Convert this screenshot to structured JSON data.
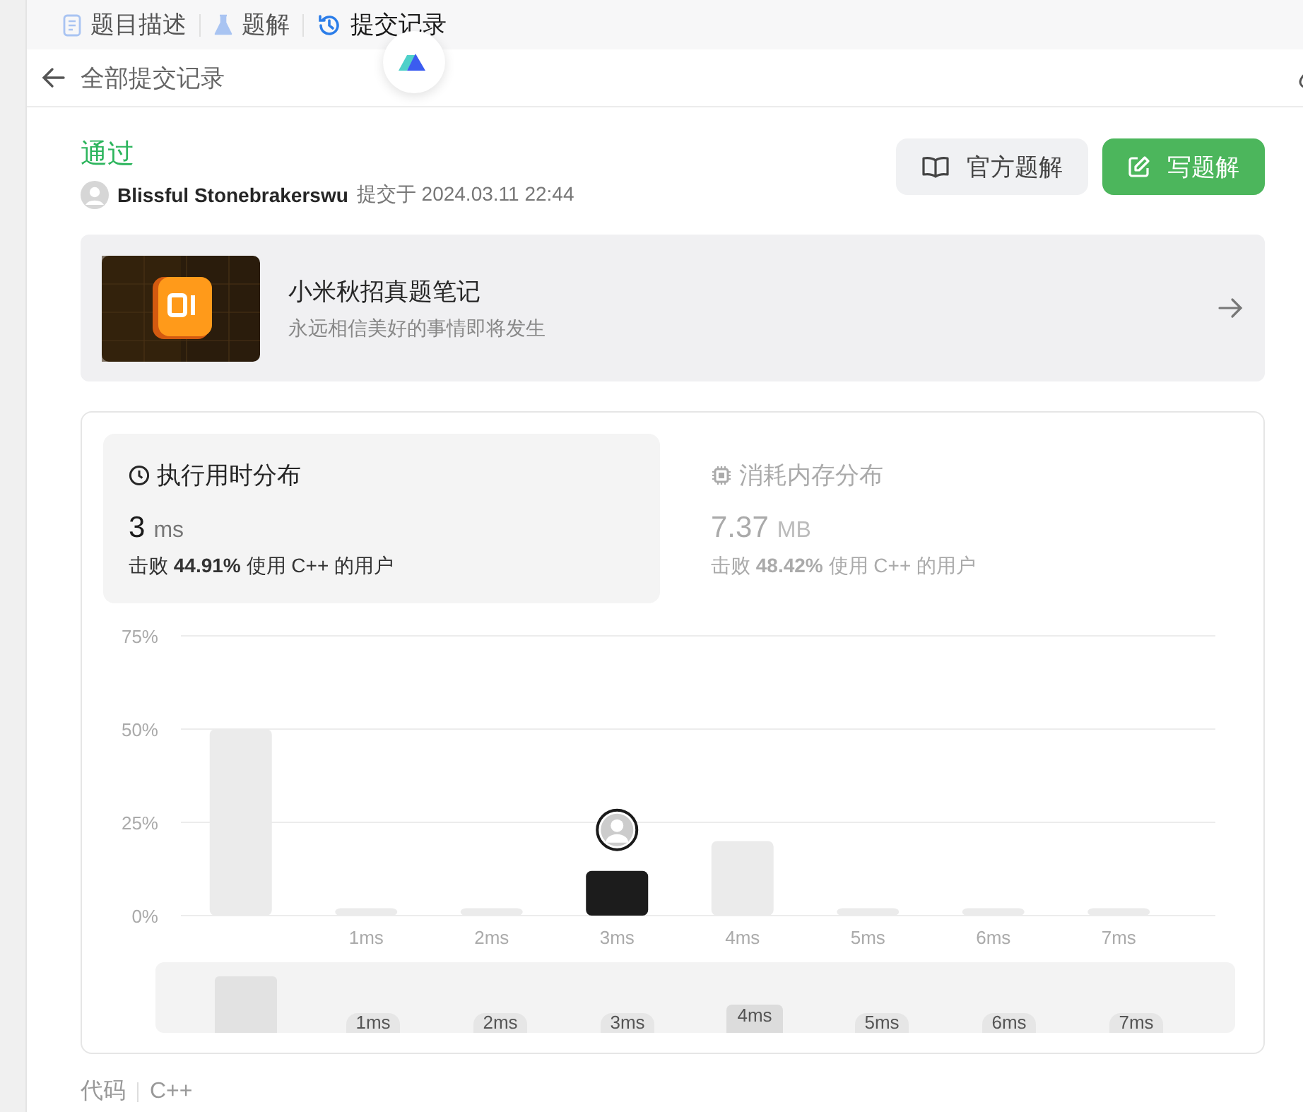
{
  "tabs": [
    {
      "label": "题目描述",
      "selected": false
    },
    {
      "label": "题解",
      "selected": false
    },
    {
      "label": "提交记录",
      "selected": true
    }
  ],
  "header": {
    "title": "全部提交记录"
  },
  "submission": {
    "status": "通过",
    "user": "Blissful Stonebrakerswu",
    "submitted_at": "提交于 2024.03.11 22:44"
  },
  "actions": [
    {
      "label": "官方题解",
      "kind": "secondary"
    },
    {
      "label": "写题解",
      "kind": "primary"
    }
  ],
  "banner": {
    "title": "小米秋招真题笔记",
    "subtitle": "永远相信美好的事情即将发生"
  },
  "metrics": [
    {
      "title": "执行用时分布",
      "value": "3",
      "unit": "ms",
      "beat_prefix": "击败",
      "beat": "44.91%",
      "beat_suffix": "使用 C++ 的用户",
      "selected": true
    },
    {
      "title": "消耗内存分布",
      "value": "7.37",
      "unit": "MB",
      "beat_prefix": "击败",
      "beat": "48.42%",
      "beat_suffix": "使用 C++ 的用户",
      "selected": false
    }
  ],
  "distribution": {
    "chart_data": {
      "type": "bar",
      "categories": [
        null,
        "1ms",
        "2ms",
        "3ms",
        "4ms",
        "5ms",
        "6ms",
        "7ms"
      ],
      "series": [
        {
          "color": "#ebebeb",
          "values": [
            50,
            2,
            2,
            null,
            20,
            2,
            2,
            2
          ]
        },
        {
          "color": "#1c1c1c",
          "values": [
            null,
            null,
            null,
            12,
            null,
            null,
            null,
            null
          ]
        }
      ],
      "ylim": [
        0,
        75
      ],
      "yticks": [
        {
          "value": 0,
          "label": "0%"
        },
        {
          "value": 25,
          "label": "25%"
        },
        {
          "value": 50,
          "label": "50%"
        },
        {
          "value": 75,
          "label": "75%"
        }
      ]
    },
    "navigator": {
      "labels": [
        {
          "label": "1ms",
          "selected": false
        },
        {
          "label": "2ms",
          "selected": false
        },
        {
          "label": "3ms",
          "selected": false
        },
        {
          "label": "4ms",
          "selected": true
        },
        {
          "label": "5ms",
          "selected": false
        },
        {
          "label": "6ms",
          "selected": false
        },
        {
          "label": "7ms",
          "selected": false
        }
      ]
    }
  },
  "footer": {
    "label": "代码",
    "language": "C++"
  }
}
